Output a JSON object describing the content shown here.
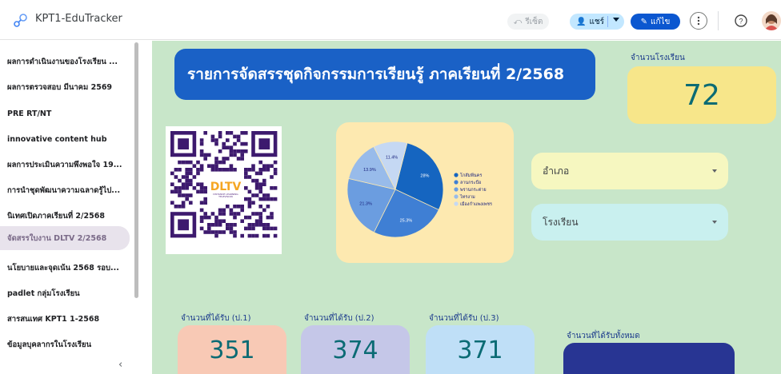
{
  "app": {
    "title": "KPT1-EduTracker"
  },
  "toolbar": {
    "undo_label": "รีเซ็ต",
    "share_label": "แชร์",
    "edit_label": "แก้ไข"
  },
  "sidebar": {
    "items": [
      {
        "label": "ผลการดำเนินงานของโรงเรียน ..."
      },
      {
        "label": "ผลการตรวจสอบ มีนาคม 2569"
      },
      {
        "label": "PRE RT/NT"
      },
      {
        "label": "innovative content hub"
      },
      {
        "label": "ผลการประเมินความพึงพอใจ 19..."
      },
      {
        "label": "การนำชุดพัฒนาความฉลาดรู้ไป..."
      },
      {
        "label": "นิเทศเปิดภาคเรียนที่ 2/2568"
      },
      {
        "label": "จัดสรรใบงาน DLTV 2/2568",
        "active": true
      },
      {
        "label": "นโยบายและจุดเน้น 2568 รอบ..."
      },
      {
        "label": "padlet กลุ่มโรงเรียน"
      },
      {
        "label": "สารสนเทศ KPT1 1-2568"
      },
      {
        "label": "ข้อมูลบุคลากรในโรงเรียน"
      }
    ],
    "collapse_glyph": "‹"
  },
  "main": {
    "title": "รายการจัดสรรชุดกิจกรรมการเรียนรู้ ภาคเรียนที่ 2/2568",
    "school_count_label": "จำนวนโรงเรียน",
    "school_count": "72",
    "qr_logo_text": "DLTV",
    "qr_logo_sub": "DISTANCE LEARNING TELEVISION",
    "filters": [
      {
        "label": "อำเภอ"
      },
      {
        "label": "โรงเรียน"
      }
    ],
    "stats": [
      {
        "label": "จำนวนที่ได้รับ (ป.1)",
        "value": "351",
        "color": "#f8c9b5"
      },
      {
        "label": "จำนวนที่ได้รับ (ป.2)",
        "value": "374",
        "color": "#c5c7e8"
      },
      {
        "label": "จำนวนที่ได้รับ (ป.3)",
        "value": "371",
        "color": "#bfdff7"
      }
    ],
    "total_label": "จำนวนที่ได้รับทั้งหมด"
  },
  "chart_data": {
    "type": "pie",
    "labels": [
      "โกสัมพีนคร",
      "ลานกระบือ",
      "พรานกระต่าย",
      "ไทรงาม",
      "เมืองกำแพงเพชร"
    ],
    "values": [
      28,
      25.3,
      21.3,
      13.9,
      11.4
    ],
    "value_labels": [
      "28%",
      "25.3%",
      "21.3%",
      "13.9%",
      "11.4%"
    ],
    "colors": [
      "#1565c0",
      "#3f7fd4",
      "#6b9de0",
      "#98bbea",
      "#c5d8f3"
    ],
    "legend_position": "right"
  }
}
